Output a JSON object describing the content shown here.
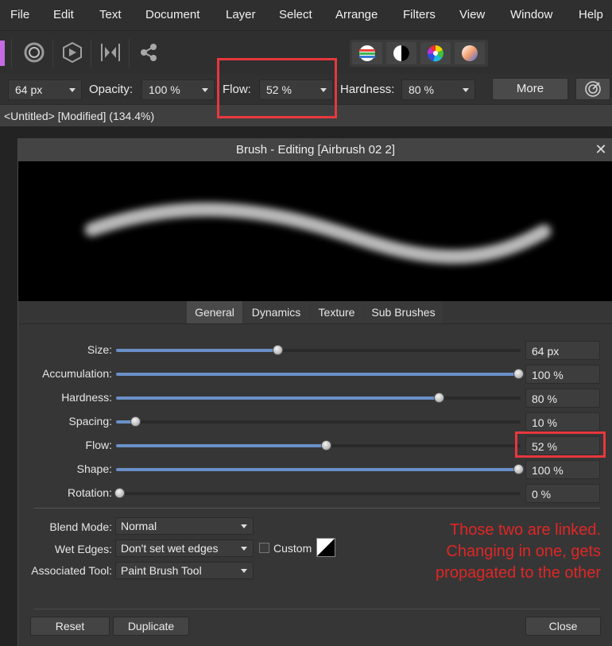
{
  "menu": [
    "File",
    "Edit",
    "Text",
    "Document",
    "Layer",
    "Select",
    "Arrange",
    "Filters",
    "View",
    "Window",
    "Help"
  ],
  "toolbar": {
    "icons": [
      "pink-swatch-icon",
      "ring-icon",
      "persona-hexagon-icon",
      "export-persona-icon",
      "share-icon"
    ],
    "persona_icons": [
      "color-balance-icon",
      "black-white-icon",
      "color-wheel-icon",
      "gradient-sphere-icon"
    ]
  },
  "context": {
    "size_value": "64 px",
    "opacity_label": "Opacity:",
    "opacity_value": "100 %",
    "flow_label": "Flow:",
    "flow_value": "52 %",
    "hardness_label": "Hardness:",
    "hardness_value": "80 %",
    "more_label": "More"
  },
  "document_tab": "<Untitled> [Modified] (134.4%)",
  "dialog": {
    "title": "Brush - Editing [Airbrush 02 2]",
    "close_glyph": "✕",
    "tabs": [
      "General",
      "Dynamics",
      "Texture",
      "Sub Brushes"
    ],
    "active_tab": "General",
    "params": [
      {
        "label": "Size:",
        "value": "64 px",
        "fraction": 0.4
      },
      {
        "label": "Accumulation:",
        "value": "100 %",
        "fraction": 1.0
      },
      {
        "label": "Hardness:",
        "value": "80 %",
        "fraction": 0.8
      },
      {
        "label": "Spacing:",
        "value": "10 %",
        "fraction": 0.05
      },
      {
        "label": "Flow:",
        "value": "52 %",
        "fraction": 0.52
      },
      {
        "label": "Shape:",
        "value": "100 %",
        "fraction": 1.0
      },
      {
        "label": "Rotation:",
        "value": "0 %",
        "fraction": 0.0
      }
    ],
    "blend_mode_label": "Blend Mode:",
    "blend_mode_value": "Normal",
    "wet_edges_label": "Wet Edges:",
    "wet_edges_value": "Don't set wet edges",
    "custom_label": "Custom",
    "associated_tool_label": "Associated Tool:",
    "associated_tool_value": "Paint Brush Tool",
    "reset_label": "Reset",
    "duplicate_label": "Duplicate",
    "close_label": "Close"
  },
  "annotation": {
    "lines": [
      "Those two are linked.",
      "Changing in one, gets",
      "propagated to the other"
    ],
    "color": "#e02626"
  },
  "colors": {
    "slider_fill": "#6a90c8",
    "annotation_box": "#e8373d"
  }
}
